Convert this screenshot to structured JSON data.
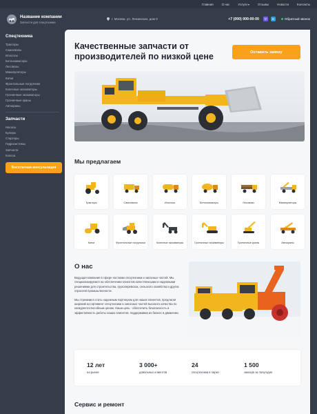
{
  "topnav": [
    "Главная",
    "О нас",
    "Услуги",
    "Отзывы",
    "Новости",
    "Контакты"
  ],
  "header": {
    "company": "Название компании",
    "tagline": "Запчасти для спецтехники",
    "address": "г. Москва, ул. Ленинская, дом 0",
    "phone": "+7 (000) 000-00-00",
    "viber": "V",
    "telegram": "➤",
    "callback": "Обратный звонок"
  },
  "sidebar": {
    "tech_title": "Спецтехника",
    "tech_items": [
      "Тракторы",
      "Самосвалы",
      "Илососы",
      "Бетономиксеры",
      "Лесовозы",
      "Манипуляторы",
      "Катки",
      "Фронтальные погрузчики",
      "Колесные экскаваторы",
      "Гусеничные экскаваторы",
      "Гусеничные краны",
      "Автокраны"
    ],
    "parts_title": "Запчасти",
    "parts_items": [
      "Насосы",
      "Кулеры",
      "Стартеры",
      "Гидросистемы",
      "Запчасти",
      "Колеса"
    ],
    "consult_button": "Бесплатная консультация"
  },
  "hero": {
    "title": "Качественные запчасти от производителей по низкой цене",
    "order_button": "Оставить заявку"
  },
  "offer": {
    "title": "Мы предлагаем",
    "cards": [
      {
        "label": "Тракторы",
        "icon": "tractor-icon"
      },
      {
        "label": "Самосвалы",
        "icon": "dump-truck-icon"
      },
      {
        "label": "Илососы",
        "icon": "vacuum-truck-icon"
      },
      {
        "label": "Бетономиксеры",
        "icon": "concrete-mixer-icon"
      },
      {
        "label": "Лесовозы",
        "icon": "timber-truck-icon"
      },
      {
        "label": "Манипуляторы",
        "icon": "crane-truck-icon"
      },
      {
        "label": "Катки",
        "icon": "road-roller-icon"
      },
      {
        "label": "Фронтальные погрузчики",
        "icon": "front-loader-icon"
      },
      {
        "label": "Колесные экскаваторы",
        "icon": "wheeled-excavator-icon"
      },
      {
        "label": "Гусеничные экскаваторы",
        "icon": "tracked-excavator-icon"
      },
      {
        "label": "Гусеничные краны",
        "icon": "crawler-crane-icon"
      },
      {
        "label": "Автокраны",
        "icon": "truck-crane-icon"
      }
    ]
  },
  "about": {
    "title": "О нас",
    "p1": "Ведущая компания в сфере поставки спецтехники и запасных частей. Мы специализируемся на обеспечении клиентов качественными и надежными решениями для строительства, грузоперевозок, сельского хозяйства и других отраслей промышленности.",
    "p2": "Мы стремимся стать надежным партнером для наших клиентов, предлагая широкий ассортимент спецтехники и запасных частей высокого качества по конкурентоспособным ценам. Наша цель - обеспечить безопасность и эффективность работы наших клиентов, поддерживая их бизнес в движении."
  },
  "stats": [
    {
      "num": "12 лет",
      "cap": "на рынке"
    },
    {
      "num": "3 000+",
      "cap": "довольных клиентов"
    },
    {
      "num": "24",
      "cap": "спецтехники в парке"
    },
    {
      "num": "1 500",
      "cap": "заказов за полугодие"
    }
  ],
  "service": {
    "title": "Сервис и ремонт"
  },
  "colors": {
    "accent": "#f7a21a",
    "dark": "#353c4a",
    "machine": "#f2b51d"
  }
}
